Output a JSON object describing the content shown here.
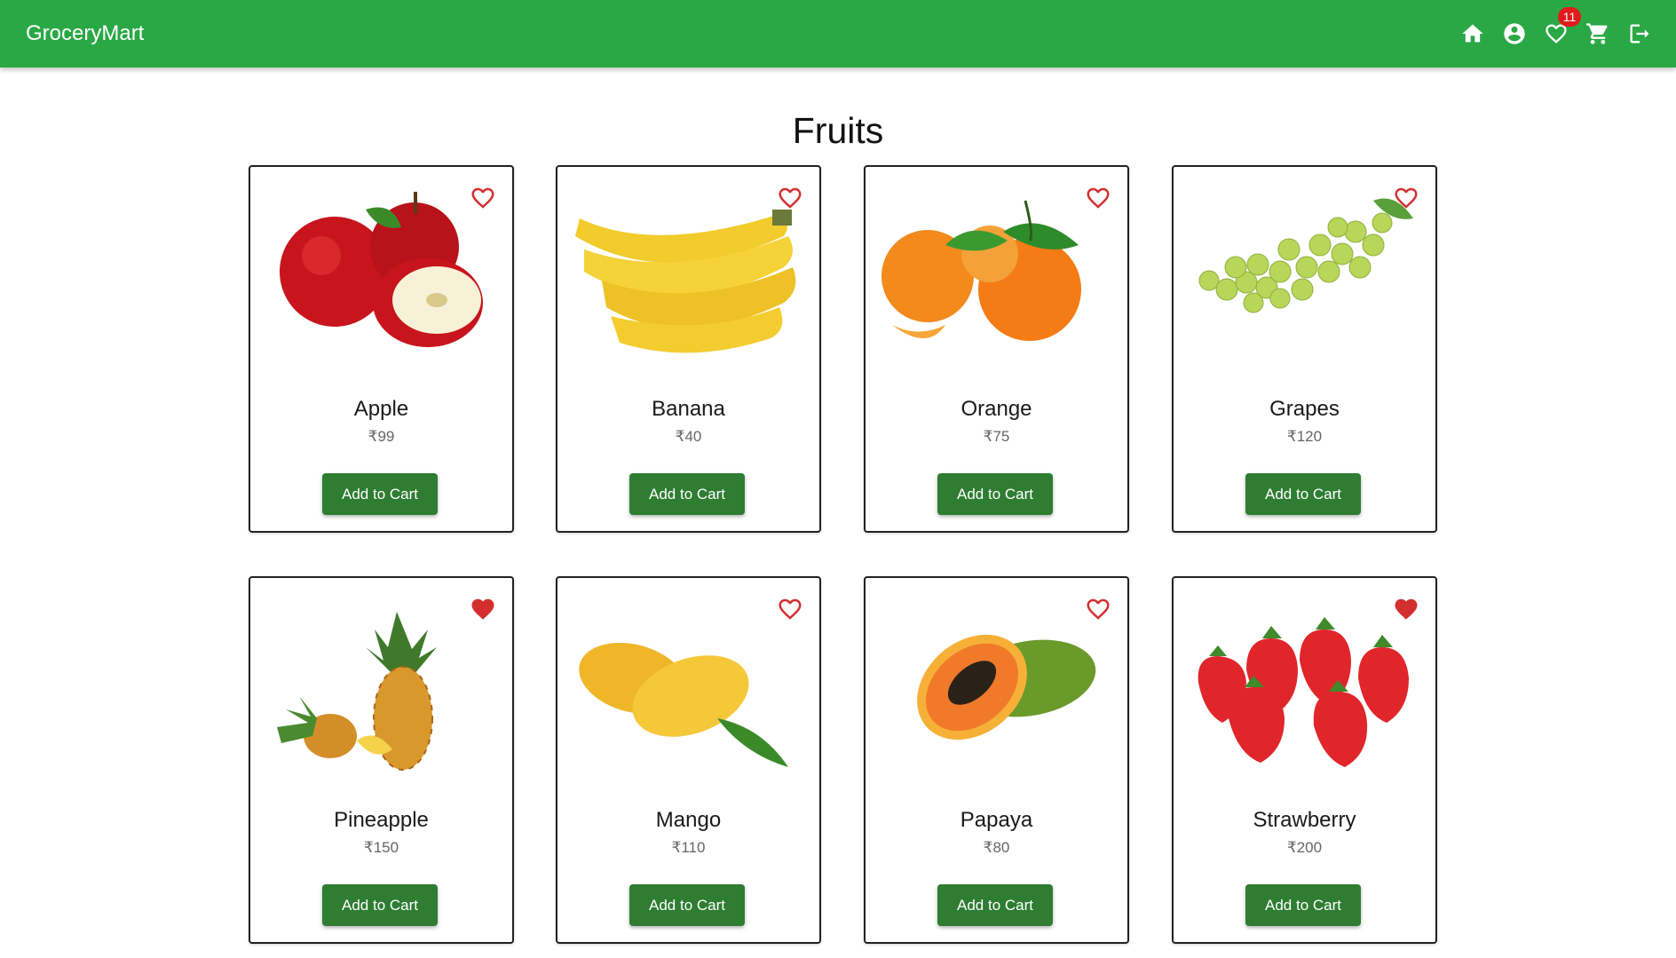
{
  "app": {
    "title": "GroceryMart"
  },
  "header": {
    "icons": [
      "home-icon",
      "account-circle-icon",
      "favorite-heart-icon",
      "cart-icon",
      "logout-icon"
    ],
    "wishlist_count": "11"
  },
  "page": {
    "title": "Fruits"
  },
  "colors": {
    "appbar": "#2aa845",
    "button": "#2e7d32",
    "heart": "#d32f2f",
    "badge": "#e01b1b"
  },
  "products": [
    {
      "name": "Apple",
      "price": "₹99",
      "button": "Add to Cart",
      "favorited": false
    },
    {
      "name": "Banana",
      "price": "₹40",
      "button": "Add to Cart",
      "favorited": false
    },
    {
      "name": "Orange",
      "price": "₹75",
      "button": "Add to Cart",
      "favorited": false
    },
    {
      "name": "Grapes",
      "price": "₹120",
      "button": "Add to Cart",
      "favorited": false
    },
    {
      "name": "Pineapple",
      "price": "₹150",
      "button": "Add to Cart",
      "favorited": true
    },
    {
      "name": "Mango",
      "price": "₹110",
      "button": "Add to Cart",
      "favorited": false
    },
    {
      "name": "Papaya",
      "price": "₹80",
      "button": "Add to Cart",
      "favorited": false
    },
    {
      "name": "Strawberry",
      "price": "₹200",
      "button": "Add to Cart",
      "favorited": true
    }
  ]
}
